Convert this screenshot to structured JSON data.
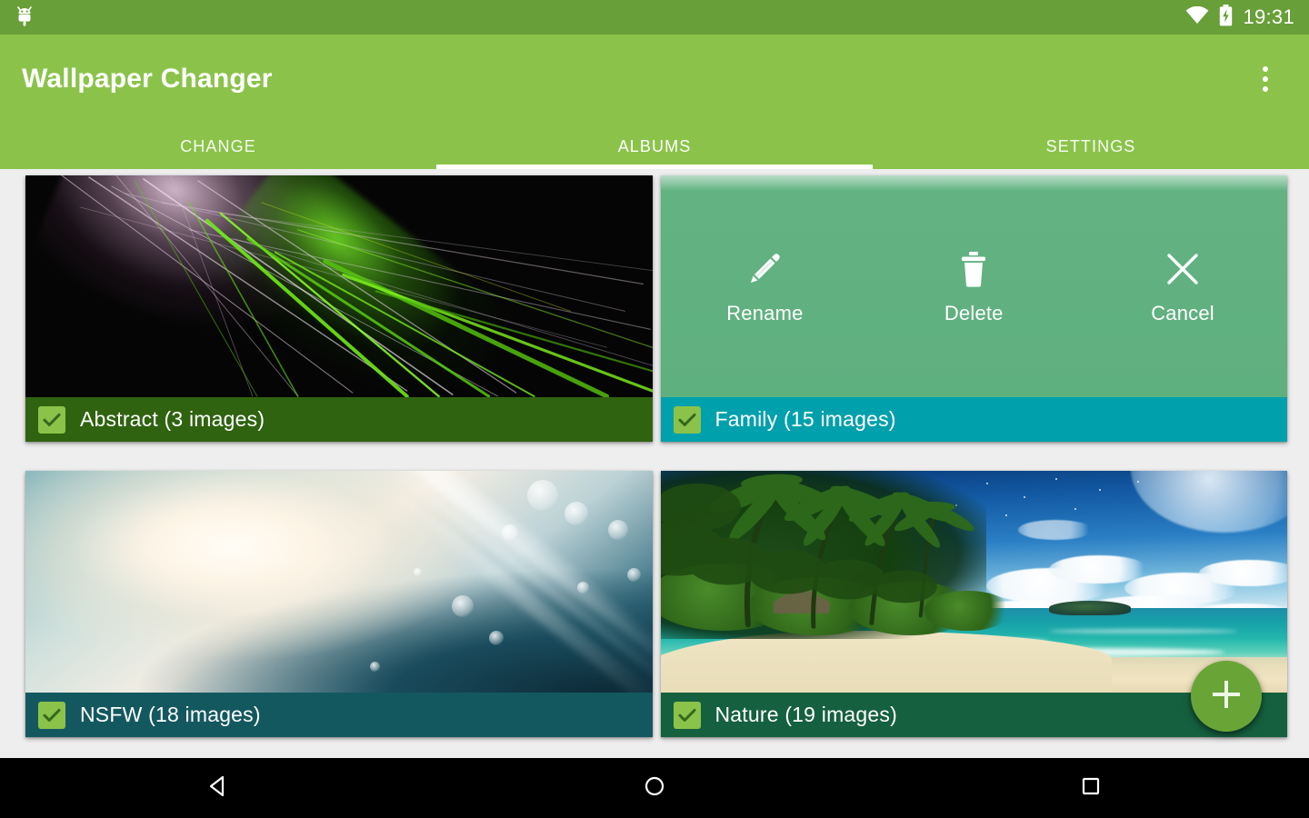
{
  "status_bar": {
    "app_icon": "android-robot-icon",
    "wifi_icon": "wifi-icon",
    "battery_icon": "battery-charging-icon",
    "time": "19:31",
    "background_color": "#689f38"
  },
  "app_bar": {
    "title": "Wallpaper Changer",
    "overflow_icon": "overflow-menu-icon",
    "background_color": "#8bc34a"
  },
  "tabs": {
    "items": [
      {
        "label": "CHANGE",
        "selected": false
      },
      {
        "label": "ALBUMS",
        "selected": true
      },
      {
        "label": "SETTINGS",
        "selected": false
      }
    ],
    "indicator_color": "#ffffff"
  },
  "albums": [
    {
      "name": "Abstract",
      "count_label": "Abstract (3 images)",
      "images": 3,
      "checked": true,
      "label_bar_color": "#2f6310",
      "thumbnail": "abstract-fractal-green-pink-on-black",
      "action_menu_open": false
    },
    {
      "name": "Family",
      "count_label": "Family (15 images)",
      "images": 15,
      "checked": true,
      "label_bar_color": "#00a0ac",
      "thumbnail": "green-action-overlay",
      "action_menu_open": true
    },
    {
      "name": "NSFW",
      "count_label": "NSFW (18 images)",
      "images": 18,
      "checked": true,
      "label_bar_color": "#14585f",
      "thumbnail": "soft-teal-cream-light-rays-bokeh",
      "action_menu_open": false
    },
    {
      "name": "Nature",
      "count_label": "Nature (19 images)",
      "images": 19,
      "checked": true,
      "label_bar_color": "#15603f",
      "thumbnail": "tropical-beach-palms-turquoise-sea",
      "action_menu_open": false
    }
  ],
  "action_menu": {
    "overlay_color": "#5fb07f",
    "items": [
      {
        "label": "Rename",
        "icon": "pencil-icon"
      },
      {
        "label": "Delete",
        "icon": "trash-icon"
      },
      {
        "label": "Cancel",
        "icon": "close-x-icon"
      }
    ]
  },
  "fab": {
    "icon": "plus-icon",
    "color": "#68a536"
  },
  "navigation_bar": {
    "back_icon": "back-triangle-icon",
    "home_icon": "home-circle-icon",
    "recents_icon": "recents-square-icon",
    "background_color": "#000000"
  },
  "page": {
    "background_color": "#eeeeee"
  }
}
